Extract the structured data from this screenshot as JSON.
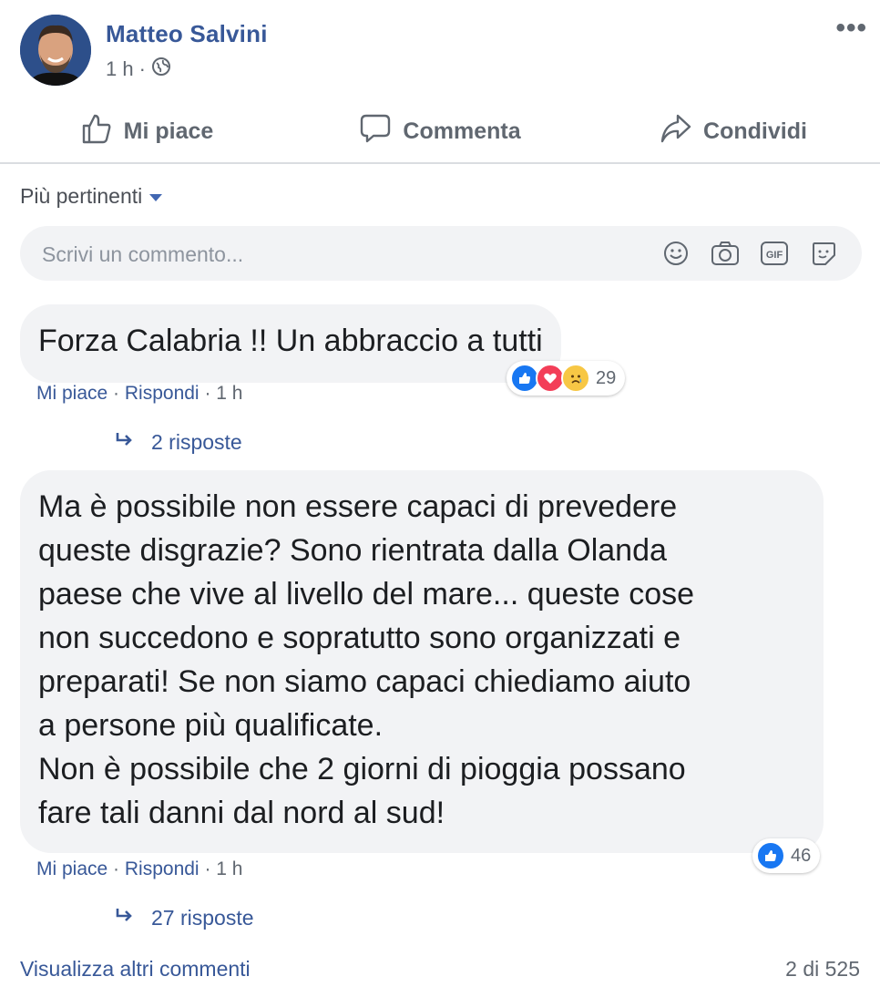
{
  "post": {
    "author": "Matteo Salvini",
    "time": "1 h",
    "separator": "·"
  },
  "actions": {
    "like": "Mi piace",
    "comment": "Commenta",
    "share": "Condividi"
  },
  "sort": {
    "label": "Più pertinenti"
  },
  "composer": {
    "placeholder": "Scrivi un commento..."
  },
  "comments": [
    {
      "text": "Forza Calabria !! Un abbraccio a tutti",
      "reaction_count": "29",
      "like": "Mi piace",
      "reply": "Rispondi",
      "time": "1 h",
      "replies": "2 risposte"
    },
    {
      "lines": [
        "Ma è possibile non essere capaci di prevedere",
        "queste disgrazie? Sono rientrata dalla Olanda",
        "paese che vive al livello del mare... queste cose",
        "non succedono e sopratutto sono organizzati e",
        "preparati! Se non siamo capaci chiediamo aiuto",
        "a persone più qualificate.",
        "Non è possibile che 2 giorni di pioggia possano",
        "fare tali danni dal nord al sud!"
      ],
      "reaction_count": "46",
      "like": "Mi piace",
      "reply": "Rispondi",
      "time": "1 h",
      "replies": "27 risposte"
    }
  ],
  "footer": {
    "more_comments": "Visualizza altri commenti",
    "count": "2 di 525"
  },
  "colors": {
    "link": "#385898",
    "bubble": "#f2f3f5",
    "like_blue": "#1877f2",
    "love_red": "#f33e58",
    "sad_yellow": "#f7c745"
  }
}
